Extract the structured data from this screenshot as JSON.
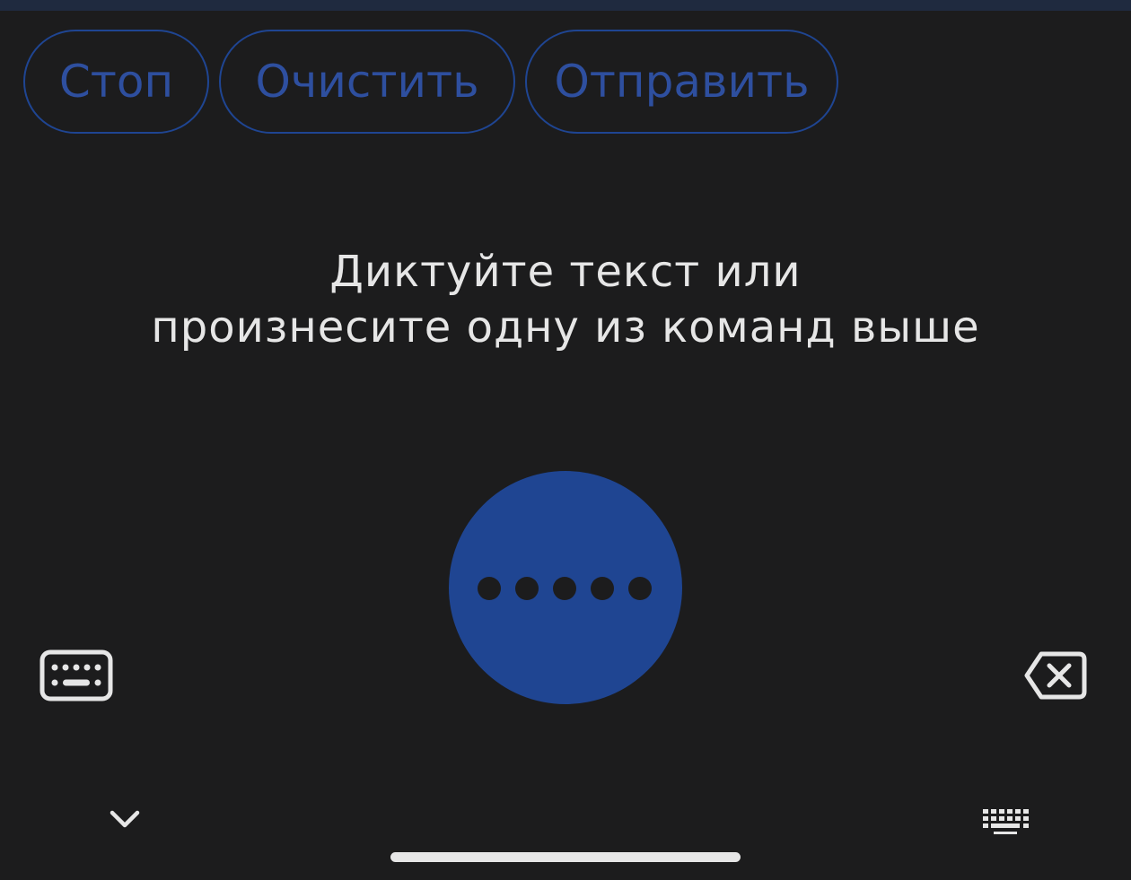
{
  "commands": {
    "stop_label": "Стоп",
    "clear_label": "Очистить",
    "send_label": "Отправить"
  },
  "hint": {
    "line1": "Диктуйте текст или",
    "line2": "произнесите одну из команд выше"
  },
  "mic": {
    "state": "listening",
    "dots": 5
  },
  "icons": {
    "keyboard": "keyboard-icon",
    "backspace": "backspace-icon",
    "hide_keyboard": "chevron-down-icon",
    "switch_keyboard": "keyboard-switch-icon"
  },
  "colors": {
    "background": "#1c1c1d",
    "accent": "#1f4592",
    "accent_text": "#2e4f9f",
    "text": "#e6e6e6"
  }
}
